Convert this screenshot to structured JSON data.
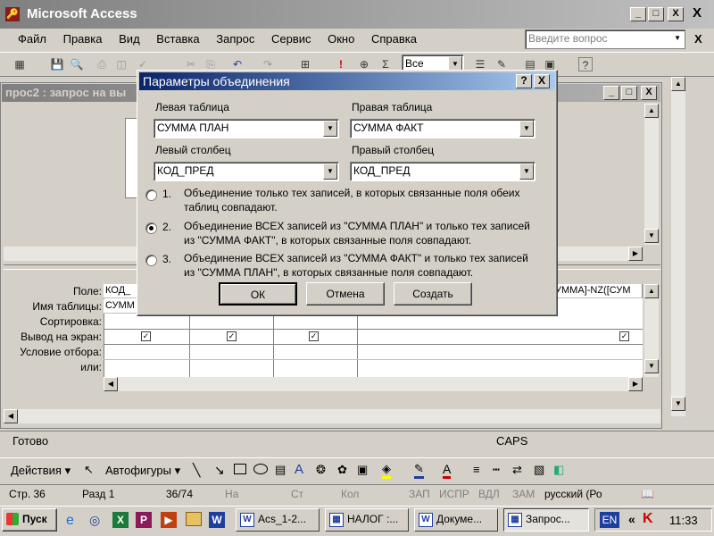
{
  "app": {
    "title": "Microsoft Access"
  },
  "menu": {
    "items": [
      "Файл",
      "Правка",
      "Вид",
      "Вставка",
      "Запрос",
      "Сервис",
      "Окно",
      "Справка"
    ],
    "help_placeholder": "Введите вопрос"
  },
  "toolbar": {
    "top_values": "Все"
  },
  "query_window": {
    "title": "прос2 : запрос на вы"
  },
  "grid": {
    "row_labels": [
      "Поле:",
      "Имя таблицы:",
      "Сортировка:",
      "Вывод на экран:",
      "Условие отбора:",
      "или:"
    ],
    "field_col1": "КОД_",
    "table_col1": "СУММ",
    "field_last": "УММА]-NZ([СУМ"
  },
  "dialog": {
    "title": "Параметры объединения",
    "left_table_label": "Левая таблица",
    "left_table_value": "СУММА ПЛАН",
    "right_table_label": "Правая таблица",
    "right_table_value": "СУММА ФАКТ",
    "left_col_label": "Левый столбец",
    "left_col_value": "КОД_ПРЕД",
    "right_col_label": "Правый столбец",
    "right_col_value": "КОД_ПРЕД",
    "options": [
      {
        "num": "1.",
        "line1": "Объединение только тех записей, в которых связанные поля обеих",
        "line2": "таблиц совпадают."
      },
      {
        "num": "2.",
        "line1": "Объединение ВСЕХ записей из \"СУММА ПЛАН\" и только тех записей",
        "line2": "из \"СУММА ФАКТ\", в которых связанные поля совпадают."
      },
      {
        "num": "3.",
        "line1": "Объединение ВСЕХ записей из \"СУММА ФАКТ\" и только тех записей",
        "line2": "из \"СУММА ПЛАН\", в которых связанные поля совпадают."
      }
    ],
    "selected_option": 2,
    "ok": "ОК",
    "cancel": "Отмена",
    "create": "Создать",
    "help_btn": "?",
    "close_btn": "X"
  },
  "status": {
    "ready": "Готово",
    "caps": "CAPS"
  },
  "drawing": {
    "actions": "Действия",
    "autoshapes": "Автофигуры"
  },
  "word_status": {
    "page": "Стр. 36",
    "section": "Разд 1",
    "pos": "36/74",
    "at": "На",
    "line": "Ст",
    "col": "Кол",
    "rec": "ЗАП",
    "trk": "ИСПР",
    "ext": "ВДЛ",
    "ovr": "ЗАМ",
    "lang": "русский (Ро"
  },
  "taskbar": {
    "start": "Пуск",
    "tasks": [
      "Acs_1-2...",
      "НАЛОГ :...",
      "Докуме...",
      "Запрос..."
    ],
    "lang": "EN",
    "clock": "11:33"
  }
}
